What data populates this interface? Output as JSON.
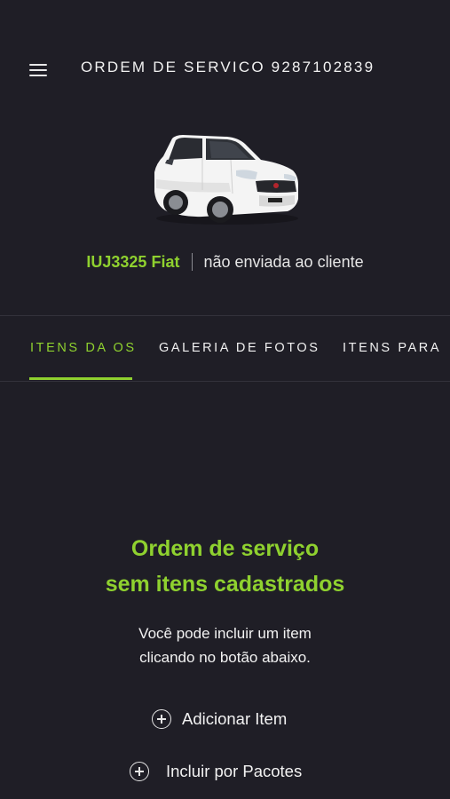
{
  "header": {
    "title": "ORDEM DE SERVICO 9287102839",
    "menu_icon": "hamburger-menu-icon"
  },
  "vehicle": {
    "image": "white-fiat-car",
    "plate_brand": "IUJ3325 Fiat",
    "status": "não enviada ao cliente"
  },
  "tabs": [
    {
      "label": "ITENS DA OS",
      "active": true
    },
    {
      "label": "GALERIA DE FOTOS",
      "active": false
    },
    {
      "label": "ITENS PARA",
      "active": false
    }
  ],
  "empty_state": {
    "title_line1": "Ordem de serviço",
    "title_line2": "sem itens cadastrados",
    "desc_line1": "Você pode incluir um item",
    "desc_line2": "clicando no botão abaixo."
  },
  "actions": {
    "add_item": "Adicionar Item",
    "include_packages": "Incluir por Pacotes",
    "icon": "plus-circle-icon"
  },
  "colors": {
    "background": "#1f1e26",
    "accent": "#8fd12f",
    "text": "#f2f2f2"
  }
}
